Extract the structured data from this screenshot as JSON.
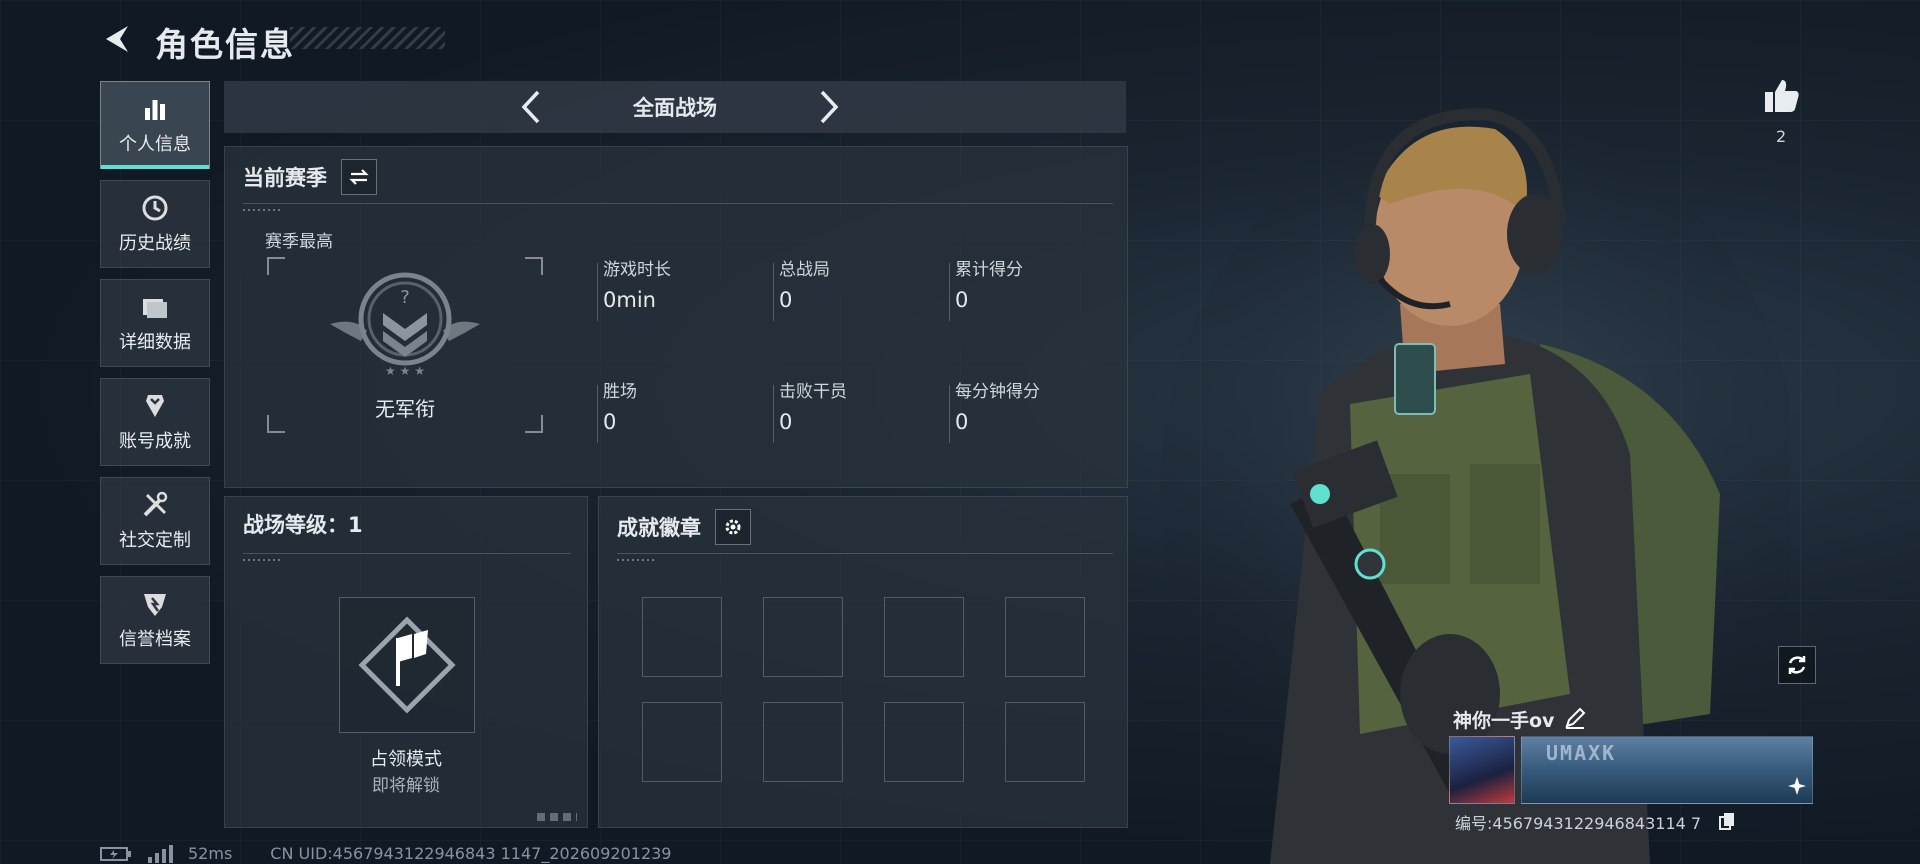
{
  "header": {
    "title": "角色信息"
  },
  "sidebar": {
    "items": [
      {
        "label": "个人信息",
        "icon": "bar-chart-icon",
        "active": true
      },
      {
        "label": "历史战绩",
        "icon": "history-icon"
      },
      {
        "label": "详细数据",
        "icon": "folder-icon"
      },
      {
        "label": "账号成就",
        "icon": "trophy-icon"
      },
      {
        "label": "社交定制",
        "icon": "tools-icon"
      },
      {
        "label": "信誉档案",
        "icon": "shield-icon"
      }
    ]
  },
  "mode": {
    "title": "全面战场"
  },
  "season": {
    "title": "当前赛季",
    "best_label": "赛季最高",
    "rank_name": "无军衔",
    "stats": [
      {
        "label": "游戏时长",
        "value": "0min"
      },
      {
        "label": "总战局",
        "value": "0"
      },
      {
        "label": "累计得分",
        "value": "0"
      },
      {
        "label": "胜场",
        "value": "0"
      },
      {
        "label": "击败干员",
        "value": "0"
      },
      {
        "label": "每分钟得分",
        "value": "0"
      }
    ]
  },
  "level": {
    "title": "战场等级：1",
    "mode_title": "占领模式",
    "mode_status": "即将解锁"
  },
  "achievements": {
    "title": "成就徽章"
  },
  "likes": {
    "count": "2"
  },
  "player": {
    "name": "神你一手ov",
    "id_text": "编号:4567943122946843114 7",
    "banner_text": "UMAXK"
  },
  "footer": {
    "ping": "52ms",
    "uid": "CN UID:4567943122946843 1147_202609201239"
  },
  "colors": {
    "accent": "#5fe0d0",
    "panel": "#28323c",
    "background": "#111a24"
  }
}
